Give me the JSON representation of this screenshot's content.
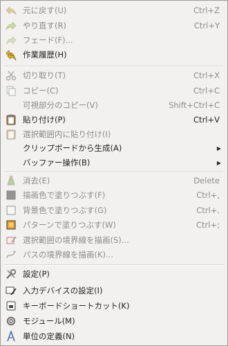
{
  "menu": {
    "items": [
      {
        "label": "元に戻す(U)",
        "shortcut": "Ctrl+Z",
        "icon": "undo-icon",
        "enabled": false
      },
      {
        "label": "やり直す(R)",
        "shortcut": "Ctrl+Y",
        "icon": "redo-icon",
        "enabled": false
      },
      {
        "label": "フェード(F)...",
        "shortcut": "",
        "icon": "fade-icon",
        "enabled": false
      },
      {
        "label": "作業履歴(H)",
        "shortcut": "",
        "icon": "history-icon",
        "enabled": true
      },
      {
        "label": "切り取り(T)",
        "shortcut": "Ctrl+X",
        "icon": "cut-icon",
        "enabled": false
      },
      {
        "label": "コピー(C)",
        "shortcut": "Ctrl+C",
        "icon": "copy-icon",
        "enabled": false
      },
      {
        "label": "可視部分のコピー(V)",
        "shortcut": "Shift+Ctrl+C",
        "icon": "",
        "enabled": false
      },
      {
        "label": "貼り付け(P)",
        "shortcut": "Ctrl+V",
        "icon": "paste-icon",
        "enabled": true
      },
      {
        "label": "選択範囲内に貼り付け(I)",
        "shortcut": "",
        "icon": "paste-into-icon",
        "enabled": false
      },
      {
        "label": "クリップボードから生成(A)",
        "shortcut": "",
        "icon": "",
        "enabled": true,
        "submenu": true
      },
      {
        "label": "バッファー操作(B)",
        "shortcut": "",
        "icon": "",
        "enabled": true,
        "submenu": true
      },
      {
        "label": "消去(E)",
        "shortcut": "Delete",
        "icon": "clear-icon",
        "enabled": false
      },
      {
        "label": "描画色で塗りつぶす(F)",
        "shortcut": "Ctrl+,",
        "icon": "fill-fg-icon",
        "enabled": false
      },
      {
        "label": "背景色で塗りつぶす(G)",
        "shortcut": "Ctrl+.",
        "icon": "fill-bg-icon",
        "enabled": false
      },
      {
        "label": "パターンで塗りつぶす(W)",
        "shortcut": "Ctrl+;",
        "icon": "fill-pattern-icon",
        "enabled": false
      },
      {
        "label": "選択範囲の境界線を描画(S)...",
        "shortcut": "",
        "icon": "stroke-selection-icon",
        "enabled": false
      },
      {
        "label": "パスの境界線を描画(K)...",
        "shortcut": "",
        "icon": "stroke-path-icon",
        "enabled": false
      },
      {
        "label": "設定(P)",
        "shortcut": "",
        "icon": "preferences-icon",
        "enabled": true
      },
      {
        "label": "入力デバイスの設定(I)",
        "shortcut": "",
        "icon": "input-devices-icon",
        "enabled": true
      },
      {
        "label": "キーボードショートカット(K)",
        "shortcut": "",
        "icon": "keyboard-icon",
        "enabled": true
      },
      {
        "label": "モジュール(M)",
        "shortcut": "",
        "icon": "modules-icon",
        "enabled": true
      },
      {
        "label": "単位の定義(N)",
        "shortcut": "",
        "icon": "units-icon",
        "enabled": true
      }
    ],
    "submenu_arrow": "▶"
  }
}
